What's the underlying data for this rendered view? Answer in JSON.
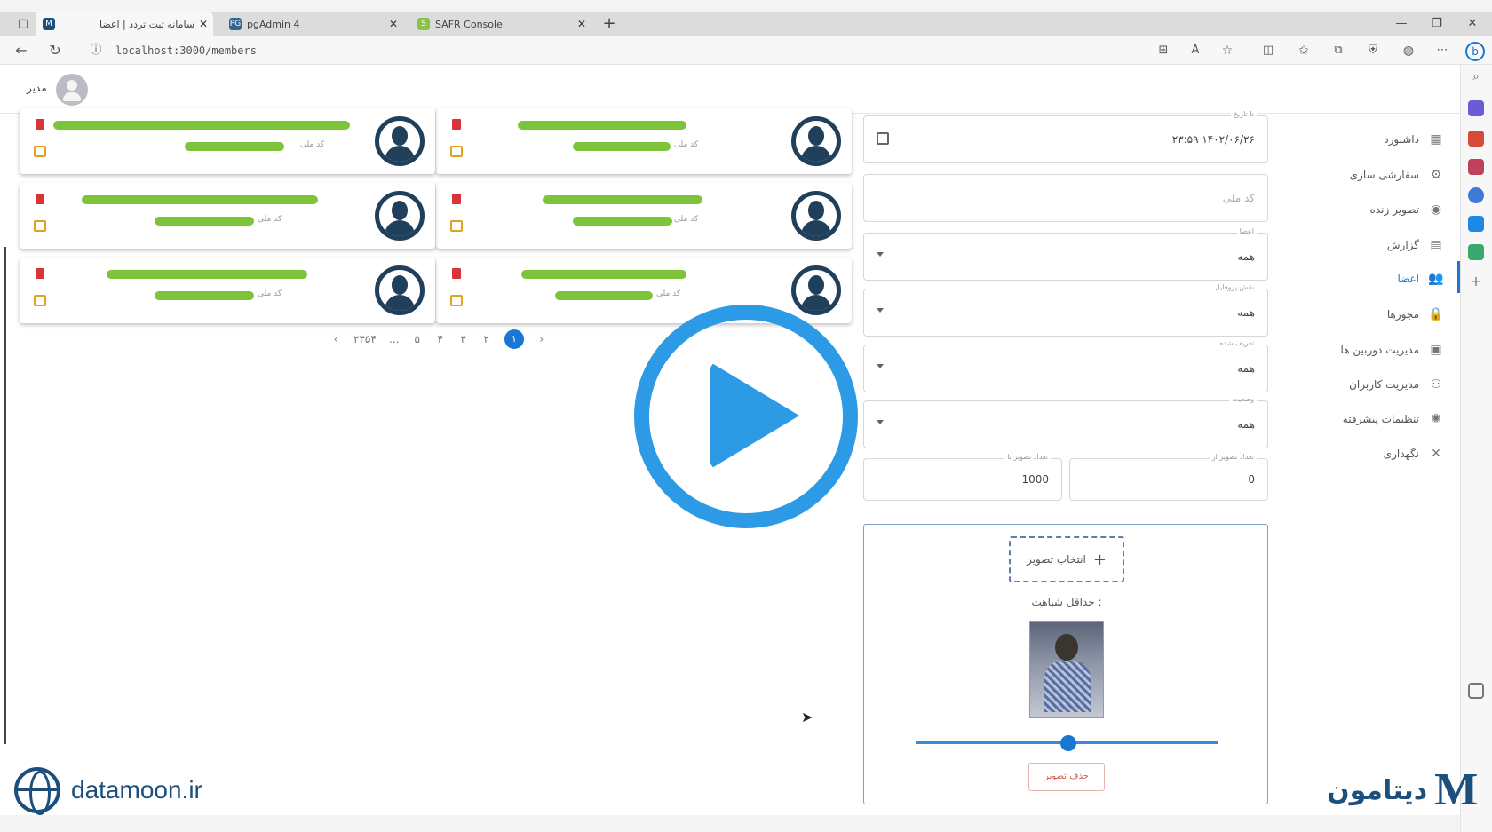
{
  "browser": {
    "tabs": [
      {
        "label": "سامانه ثبت تردد | اعضا",
        "favicon": "M",
        "active": true
      },
      {
        "label": "pgAdmin 4",
        "favicon": "PG",
        "active": false
      },
      {
        "label": "SAFR Console",
        "favicon": "S",
        "active": false
      }
    ],
    "new_tab": "+",
    "url": "localhost:3000/members",
    "window_controls": {
      "minimize": "—",
      "maximize": "❐",
      "close": "✕"
    }
  },
  "header": {
    "user_name": "مدیر",
    "collapse_icon": "›"
  },
  "sidebar": {
    "items": [
      {
        "label": "داشبورد",
        "icon": "dashboard-icon",
        "glyph": "▦"
      },
      {
        "label": "سفارشی سازی",
        "icon": "gear-icon",
        "glyph": "⚙"
      },
      {
        "label": "تصویر زنده",
        "icon": "camera-icon",
        "glyph": "◉"
      },
      {
        "label": "گزارش",
        "icon": "report-icon",
        "glyph": "▤"
      },
      {
        "label": "اعضا",
        "icon": "members-icon",
        "glyph": "👥"
      },
      {
        "label": "مجوزها",
        "icon": "lock-icon",
        "glyph": "🔒"
      },
      {
        "label": "مدیریت دوربین ها",
        "icon": "camera-manage-icon",
        "glyph": "▣"
      },
      {
        "label": "مدیریت کاربران",
        "icon": "user-manage-icon",
        "glyph": "⚇"
      },
      {
        "label": "تنظیمات پیشرفته",
        "icon": "advanced-settings-icon",
        "glyph": "✺"
      },
      {
        "label": "نگهداری",
        "icon": "tools-icon",
        "glyph": "✕"
      }
    ],
    "active_index": 4
  },
  "members": {
    "nid_label": "کد ملی",
    "cards": [
      {
        "col": "right",
        "row": 0
      },
      {
        "col": "left",
        "row": 0
      },
      {
        "col": "right",
        "row": 1
      },
      {
        "col": "left",
        "row": 1
      },
      {
        "col": "right",
        "row": 2
      },
      {
        "col": "left",
        "row": 2
      }
    ]
  },
  "pagination": {
    "prev": "‹",
    "next": "›",
    "pages": [
      "۲۳۵۴",
      "...",
      "۵",
      "۴",
      "۳",
      "۲",
      "۱"
    ],
    "current": "۱"
  },
  "filters": {
    "date": {
      "label": "تا تاریخ",
      "value": "۲۳:۵۹ ۱۴۰۲/۰۶/۲۶"
    },
    "national_id": {
      "placeholder": "کد ملی"
    },
    "members": {
      "label": "اعضا",
      "value": "همه"
    },
    "profile_type": {
      "label": "نقش پروفایل",
      "value": "همه"
    },
    "defined": {
      "label": "تعریف شده",
      "value": "همه"
    },
    "status": {
      "label": "وضعیت",
      "value": "همه"
    },
    "image_count_to": {
      "label": "تعداد تصویر تا",
      "value": "1000"
    },
    "image_count_from": {
      "label": "تعداد تصویر از",
      "value": "0"
    }
  },
  "upload": {
    "pick_label": "انتخاب تصویر",
    "min_similarity": "حداقل شباهت :",
    "delete_label": "حذف تصویر",
    "similarity_value": 0.5
  },
  "watermark": {
    "site": "datamoon.ir",
    "brand_fa": "دیتامون"
  },
  "colors": {
    "accent": "#1976d2",
    "play_overlay": "#2d9ae6",
    "redaction": "#7ec43a",
    "brand": "#1d4f7c"
  }
}
